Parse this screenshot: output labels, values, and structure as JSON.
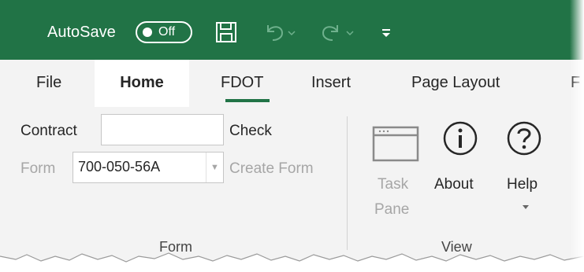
{
  "titlebar": {
    "autosave_label": "AutoSave",
    "autosave_state": "Off",
    "accent_color": "#217346"
  },
  "tabs": [
    {
      "label": "File"
    },
    {
      "label": "Home"
    },
    {
      "label": "FDOT"
    },
    {
      "label": "Insert"
    },
    {
      "label": "Page Layout"
    },
    {
      "label": "F"
    }
  ],
  "form_group": {
    "contract_label": "Contract",
    "contract_value": "",
    "check_label": "Check",
    "form_label": "Form",
    "form_value": "700-050-56A",
    "create_form_label": "Create Form",
    "group_label": "Form"
  },
  "view_group": {
    "task_pane_line1": "Task",
    "task_pane_line2": "Pane",
    "about_label": "About",
    "help_label": "Help",
    "group_label": "View"
  },
  "icons": [
    "save-icon",
    "undo-icon",
    "redo-icon",
    "customize-qat-icon",
    "task-pane-icon",
    "info-icon",
    "help-question-icon"
  ]
}
